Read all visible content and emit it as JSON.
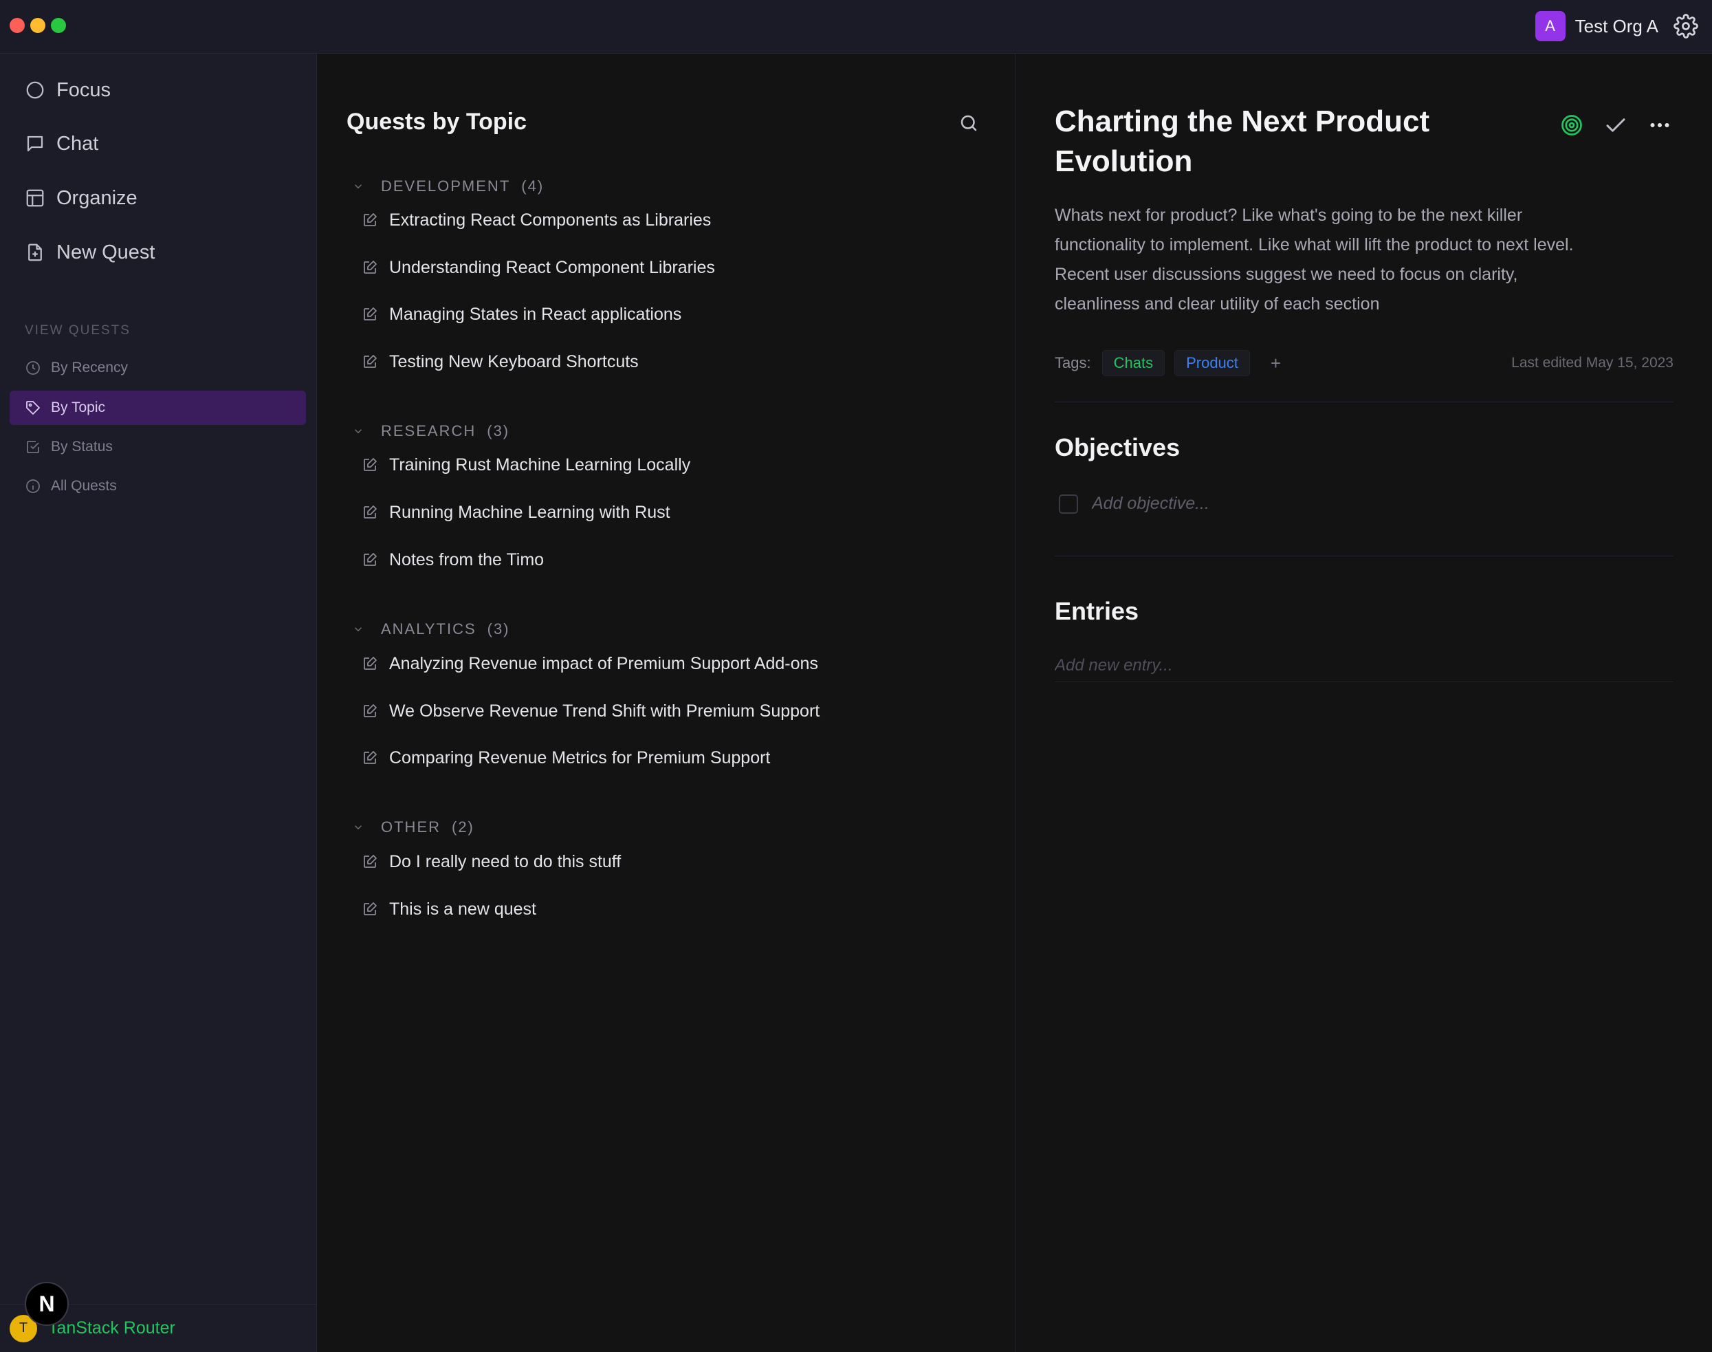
{
  "window": {
    "controls": [
      "close",
      "minimize",
      "maximize"
    ]
  },
  "org": {
    "avatar_letter": "A",
    "name": "Test Org A",
    "icon": "gear-icon"
  },
  "sidebar": {
    "nav": [
      {
        "label": "Focus",
        "icon": "circle-icon"
      },
      {
        "label": "Chat",
        "icon": "chat-icon"
      },
      {
        "label": "Organize",
        "icon": "layout-icon"
      },
      {
        "label": "New Quest",
        "icon": "new-file-icon"
      }
    ],
    "section_label": "VIEW QUESTS",
    "views": [
      {
        "label": "By Recency",
        "icon": "clock-icon",
        "active": false
      },
      {
        "label": "By Topic",
        "icon": "tag-icon",
        "active": true
      },
      {
        "label": "By Status",
        "icon": "check-square-icon",
        "active": false
      },
      {
        "label": "All Quests",
        "icon": "info-icon",
        "active": false
      }
    ],
    "footer": {
      "avatar_letter": "T",
      "label": "TanStack Router",
      "badge": "N"
    }
  },
  "list": {
    "title": "Quests by Topic",
    "groups": [
      {
        "name": "DEVELOPMENT",
        "count": "(4)",
        "items": [
          "Extracting React Components as Libraries",
          "Understanding React Component Libraries",
          "Managing States in React applications",
          "Testing New Keyboard Shortcuts"
        ]
      },
      {
        "name": "RESEARCH",
        "count": "(3)",
        "items": [
          "Training Rust Machine Learning Locally",
          "Running Machine Learning with Rust",
          "Notes from the Timo"
        ]
      },
      {
        "name": "ANALYTICS",
        "count": "(3)",
        "items": [
          "Analyzing Revenue impact of Premium Support Add-ons",
          "We Observe Revenue Trend Shift with Premium Support",
          "Comparing Revenue Metrics for Premium Support"
        ]
      },
      {
        "name": "OTHER",
        "count": "(2)",
        "items": [
          "Do I really need to do this stuff",
          "This is a new quest"
        ]
      }
    ]
  },
  "detail": {
    "title": "Charting the Next Product Evolution",
    "description": "Whats next for product? Like what's going to be the next killer functionality to implement. Like what will lift the product to next level. Recent user discussions suggest we need to focus on clarity, cleanliness and clear utility of each section",
    "tags_label": "Tags:",
    "tags": [
      {
        "label": "Chats",
        "color": "#22c55e"
      },
      {
        "label": "Product",
        "color": "#3b82f6"
      }
    ],
    "tag_add": "+",
    "last_edited": "Last edited May 15, 2023",
    "objectives_title": "Objectives",
    "objective_placeholder": "Add objective...",
    "entries_title": "Entries",
    "entry_placeholder": "Add new entry..."
  },
  "colors": {
    "accent": "#9333ea",
    "active_bg": "#3b1d5e",
    "focus_green": "#22c55e"
  }
}
